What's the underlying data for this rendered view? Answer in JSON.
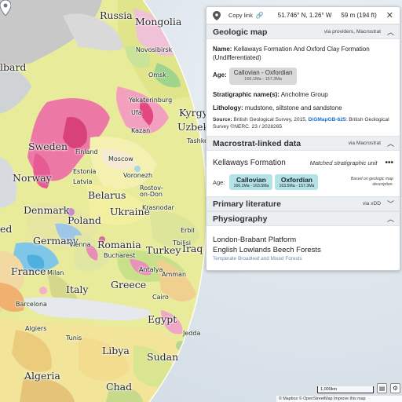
{
  "header": {
    "copy_link": "Copy link",
    "link_icon": "link-icon",
    "coordinates": "51.746° N, 1.26° W",
    "elevation": "59 m (194 ft)",
    "close": "✕"
  },
  "geologic_map": {
    "title": "Geologic map",
    "source": "via providers, Macrostrat",
    "name_label": "Name:",
    "name_value": "Kellaways Formation And Oxford Clay Formation (Undifferentiated)",
    "age_label": "Age:",
    "age_name": "Callovian - Oxfordian",
    "age_range": "166.1Ma - 157.3Ma",
    "strat_label": "Stratigraphic name(s):",
    "strat_value": "Ancholme Group",
    "lith_label": "Lithology:",
    "lith_value": "mudstone, siltstone and sandstone",
    "source_label": "Source:",
    "source_text": "British Geological Survey, 2015,",
    "source_link": "DiGMapGB-625",
    "source_tail": ": British Geological Survey ©NERC. 23 / 2028265"
  },
  "macrostrat": {
    "title": "Macrostrat-linked data",
    "source": "via Macrostrat",
    "unit": "Kellaways Formation",
    "matched": "Matched stratigraphic unit",
    "more": "•••",
    "age_label": "Age:",
    "intervals": [
      {
        "name": "Callovian",
        "range": "166.1Ma - 163.5Ma"
      },
      {
        "name": "Oxfordian",
        "range": "163.5Ma - 157.3Ma"
      }
    ],
    "based_on": "Based on geologic map description."
  },
  "literature": {
    "title": "Primary literature",
    "source": "via xDD"
  },
  "physiography": {
    "title": "Physiography",
    "line1": "London-Brabant Platform",
    "line2": "English Lowlands Beech Forests",
    "line3": "Temperate Broadleaf and Mixed Forests"
  },
  "map": {
    "labels": {
      "russia": "Russia",
      "mongolia": "Mongolia",
      "novosibirsk": "Novosibirsk",
      "omsk": "Omsk",
      "yekaterinburg": "Yekaterinburg",
      "ufa": "Ufa",
      "kazan": "Kazan",
      "kyrgyzstan": "Kyrgyzs",
      "uzbekistan": "Uzbekist",
      "sweden": "Sweden",
      "norway": "Norway",
      "finland": "Finland",
      "estonia": "Estonia",
      "latvia": "Latvia",
      "moscow": "Moscow",
      "voronezh": "Voronezh",
      "rostov": "Rostov-on-Don",
      "belarus": "Belarus",
      "ukraine": "Ukraine",
      "krasnodar": "Krasnodar",
      "denmark": "Denmark",
      "poland": "Poland",
      "germany": "Germany",
      "romania": "Romania",
      "vienna": "Vienna",
      "bucharest": "Bucharest",
      "turkey": "Turkey",
      "iraq": "Iraq",
      "erbil": "Erbil",
      "tbilisi": "Tbilisi",
      "france": "France",
      "milan": "Milan",
      "italy": "Italy",
      "greece": "Greece",
      "antalya": "Antalya",
      "amman": "Amman",
      "cairo": "Cairo",
      "egypt": "Egypt",
      "jeddah": "Jedda",
      "tunis": "Tunis",
      "algiers": "Algiers",
      "barcelona": "Barcelona",
      "libya": "Libya",
      "sudan": "Sudan",
      "algeria": "Algeria",
      "chad": "Chad",
      "svalbard": "lbard",
      "fragment": "ed",
      "tashkent": "Tashkent"
    },
    "scale": "1,000km",
    "attribution": "© Mapbox © OpenStreetMap Improve this map"
  },
  "colors": {
    "accent_blue": "#1a6fd1",
    "chip_grey": "#d8d8d8",
    "chip_teal": "#b3e3e6",
    "section_bg": "#eceff1"
  }
}
